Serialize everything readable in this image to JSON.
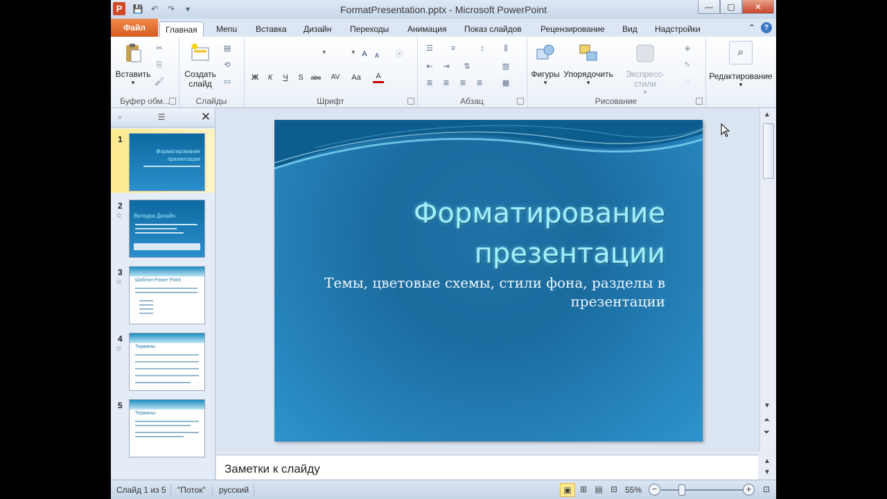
{
  "window": {
    "title": "FormatPresentation.pptx - Microsoft PowerPoint",
    "app_badge": "P",
    "controls": {
      "minimize": "—",
      "maximize": "▢",
      "close": "✕"
    }
  },
  "qat": {
    "save": "💾",
    "undo": "↶",
    "redo": "↷",
    "customize": "▾"
  },
  "tabs": {
    "file": "Файл",
    "items": [
      "Главная",
      "Menu",
      "Вставка",
      "Дизайн",
      "Переходы",
      "Анимация",
      "Показ слайдов",
      "Рецензирование",
      "Вид",
      "Надстройки"
    ],
    "active": "Главная",
    "collapse": "⌃",
    "help": "?"
  },
  "ribbon": {
    "clipboard": {
      "label": "Буфер обм...",
      "paste": "Вставить"
    },
    "slides": {
      "label": "Слайды",
      "new_slide_1": "Создать",
      "new_slide_2": "слайд"
    },
    "font": {
      "label": "Шрифт",
      "bold": "Ж",
      "italic": "К",
      "underline": "Ч",
      "strike": "S",
      "shadow": "abc",
      "spacing": "AV",
      "case": "Aa",
      "color": "A",
      "grow": "A",
      "shrink": "A"
    },
    "paragraph": {
      "label": "Абзац"
    },
    "drawing": {
      "label": "Рисование",
      "shapes": "Фигуры",
      "arrange": "Упорядочить",
      "quick_styles": "Экспресс-стили"
    },
    "editing": {
      "label": "Редактирование"
    }
  },
  "thumbnails": {
    "slides": [
      {
        "num": "1",
        "title": "Форматирование презентации",
        "selected": true
      },
      {
        "num": "2",
        "title": "Вкладка Дизайн",
        "selected": false
      },
      {
        "num": "3",
        "title": "Шаблон Power Point",
        "selected": false
      },
      {
        "num": "4",
        "title": "Термины",
        "selected": false
      },
      {
        "num": "5",
        "title": "Термины",
        "selected": false
      }
    ],
    "close": "✕"
  },
  "slide": {
    "title_line1": "Форматирование",
    "title_line2": "презентации",
    "subtitle_line1": "Темы, цветовые схемы, стили фона, разделы в",
    "subtitle_line2": "презентации"
  },
  "notes": {
    "placeholder": "Заметки к слайду"
  },
  "status": {
    "slide_info": "Слайд 1 из 5",
    "theme": "\"Поток\"",
    "language": "русский",
    "zoom": "55%",
    "zoom_level_fraction": 0.2
  },
  "colors": {
    "file_tab": "#d45a1e",
    "slide_bg": "#1f72a6",
    "title_text": "#9ff0ff"
  }
}
